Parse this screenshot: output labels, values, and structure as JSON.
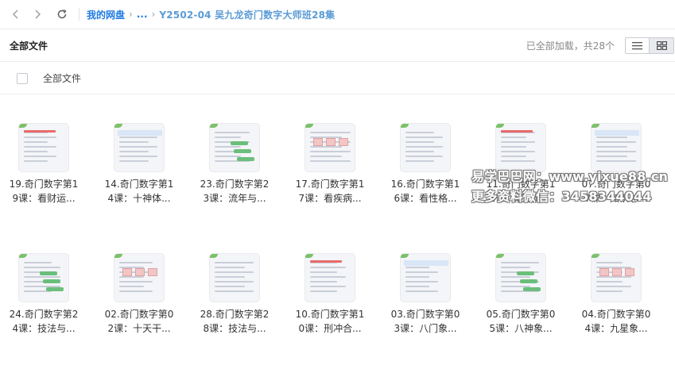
{
  "nav": {
    "root": "我的网盘",
    "ellipsis": "...",
    "current_folder": "Y2502-04 吴九龙奇门数字大师班28集"
  },
  "header": {
    "title": "全部文件",
    "status": "已全部加载，共28个"
  },
  "select_all_label": "全部文件",
  "files": [
    {
      "line1": "19.奇门数字第1",
      "line2": "9课：看财运..."
    },
    {
      "line1": "14.奇门数字第1",
      "line2": "4课：十神体..."
    },
    {
      "line1": "23.奇门数字第2",
      "line2": "3课：流年与..."
    },
    {
      "line1": "17.奇门数字第1",
      "line2": "7课：看疾病..."
    },
    {
      "line1": "16.奇门数字第1",
      "line2": "6课：看性格..."
    },
    {
      "line1": "11.奇门数字第1",
      "line2": "1课：能量磁..."
    },
    {
      "line1": "07.奇门数字第0",
      "line2": "7课：知识总..."
    },
    {
      "line1": "24.奇门数字第2",
      "line2": "4课：技法与..."
    },
    {
      "line1": "02.奇门数字第0",
      "line2": "2课：十天干..."
    },
    {
      "line1": "28.奇门数字第2",
      "line2": "8课：技法与..."
    },
    {
      "line1": "10.奇门数字第1",
      "line2": "0课：刑冲合..."
    },
    {
      "line1": "03.奇门数字第0",
      "line2": "3课：八门象..."
    },
    {
      "line1": "05.奇门数字第0",
      "line2": "5课：八神象..."
    },
    {
      "line1": "04.奇门数字第0",
      "line2": "4课：九星象..."
    }
  ],
  "watermark": {
    "line1": "易学巴巴网：www.yixue88.cn",
    "line2": "更多资料微信：3458344044"
  },
  "colors": {
    "link": "#1f7ae0",
    "breadcrumb_current": "#5b9bd5",
    "thumb_accent": "#7cc06a"
  },
  "icons": {
    "back": "chevron-left-icon",
    "forward": "chevron-right-icon",
    "refresh": "refresh-icon",
    "list_view": "list-view-icon",
    "grid_view": "grid-view-icon"
  }
}
